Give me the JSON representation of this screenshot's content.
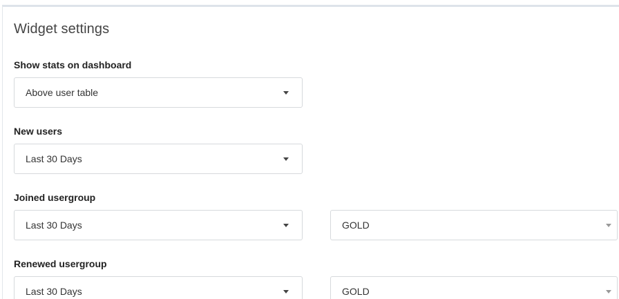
{
  "panel": {
    "title": "Widget settings"
  },
  "fields": {
    "show_stats": {
      "label": "Show stats on dashboard",
      "value": "Above user table"
    },
    "new_users": {
      "label": "New users",
      "value": "Last 30 Days"
    },
    "joined_usergroup": {
      "label": "Joined usergroup",
      "period": "Last 30 Days",
      "group": "GOLD"
    },
    "renewed_usergroup": {
      "label": "Renewed usergroup",
      "period": "Last 30 Days",
      "group": "GOLD"
    }
  }
}
